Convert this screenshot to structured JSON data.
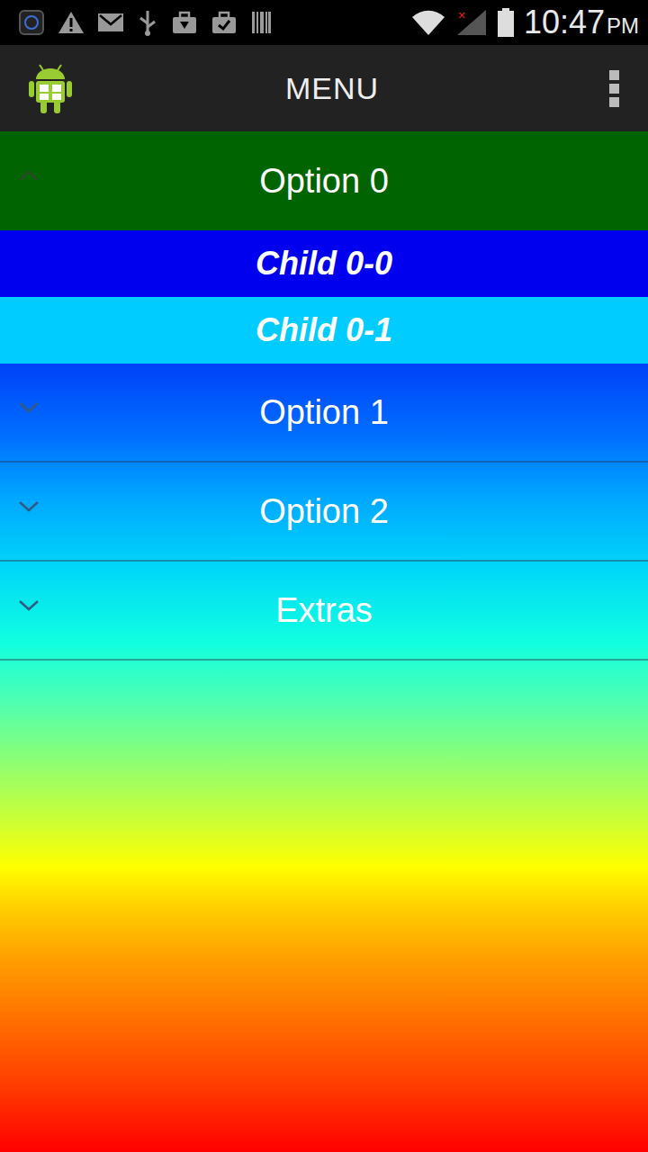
{
  "status_bar": {
    "time": "10:47",
    "ampm": "PM"
  },
  "action_bar": {
    "title": "MENU"
  },
  "groups": [
    {
      "label": "Option 0",
      "expanded": true,
      "children": [
        {
          "label": "Child 0-0",
          "color": "#0000ee"
        },
        {
          "label": "Child 0-1",
          "color": "#00ccff"
        }
      ]
    },
    {
      "label": "Option 1",
      "expanded": false,
      "children": []
    },
    {
      "label": "Option 2",
      "expanded": false,
      "children": []
    },
    {
      "label": "Extras",
      "expanded": false,
      "children": []
    }
  ]
}
